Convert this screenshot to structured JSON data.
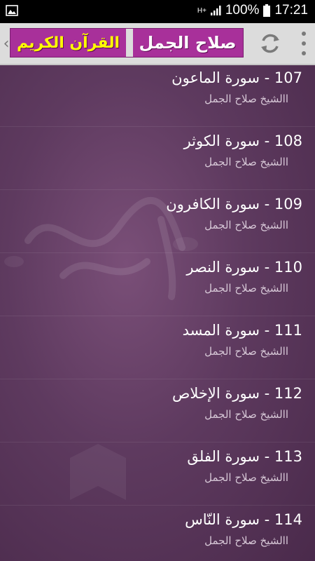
{
  "status_bar": {
    "network_label": "H+",
    "battery": "100%",
    "time": "17:21"
  },
  "toolbar": {
    "banner_left": "القرآن الكريم",
    "banner_right": "صلاح الجمل",
    "icons": [
      "chevron-left-icon",
      "refresh-icon",
      "overflow-menu-icon"
    ]
  },
  "colors": {
    "banner_bg": "#a8309a",
    "banner_left_text": "#ffff00",
    "list_bg": "#5e3a5f"
  },
  "list": {
    "items": [
      {
        "title": "107 - سورة الماعون",
        "subtitle": "االشيخ صلاح الجمل"
      },
      {
        "title": "108 - سورة الكوثر",
        "subtitle": "االشيخ صلاح الجمل"
      },
      {
        "title": "109 - سورة الكافرون",
        "subtitle": "االشيخ صلاح الجمل"
      },
      {
        "title": "110 - سورة النصر",
        "subtitle": "االشيخ صلاح الجمل"
      },
      {
        "title": "111 - سورة المسد",
        "subtitle": "االشيخ صلاح الجمل"
      },
      {
        "title": "112 - سورة الإخلاص",
        "subtitle": "االشيخ صلاح الجمل"
      },
      {
        "title": "113 - سورة الفلق",
        "subtitle": "االشيخ صلاح الجمل"
      },
      {
        "title": "114 - سورة النّاس",
        "subtitle": "االشيخ صلاح الجمل"
      }
    ]
  }
}
